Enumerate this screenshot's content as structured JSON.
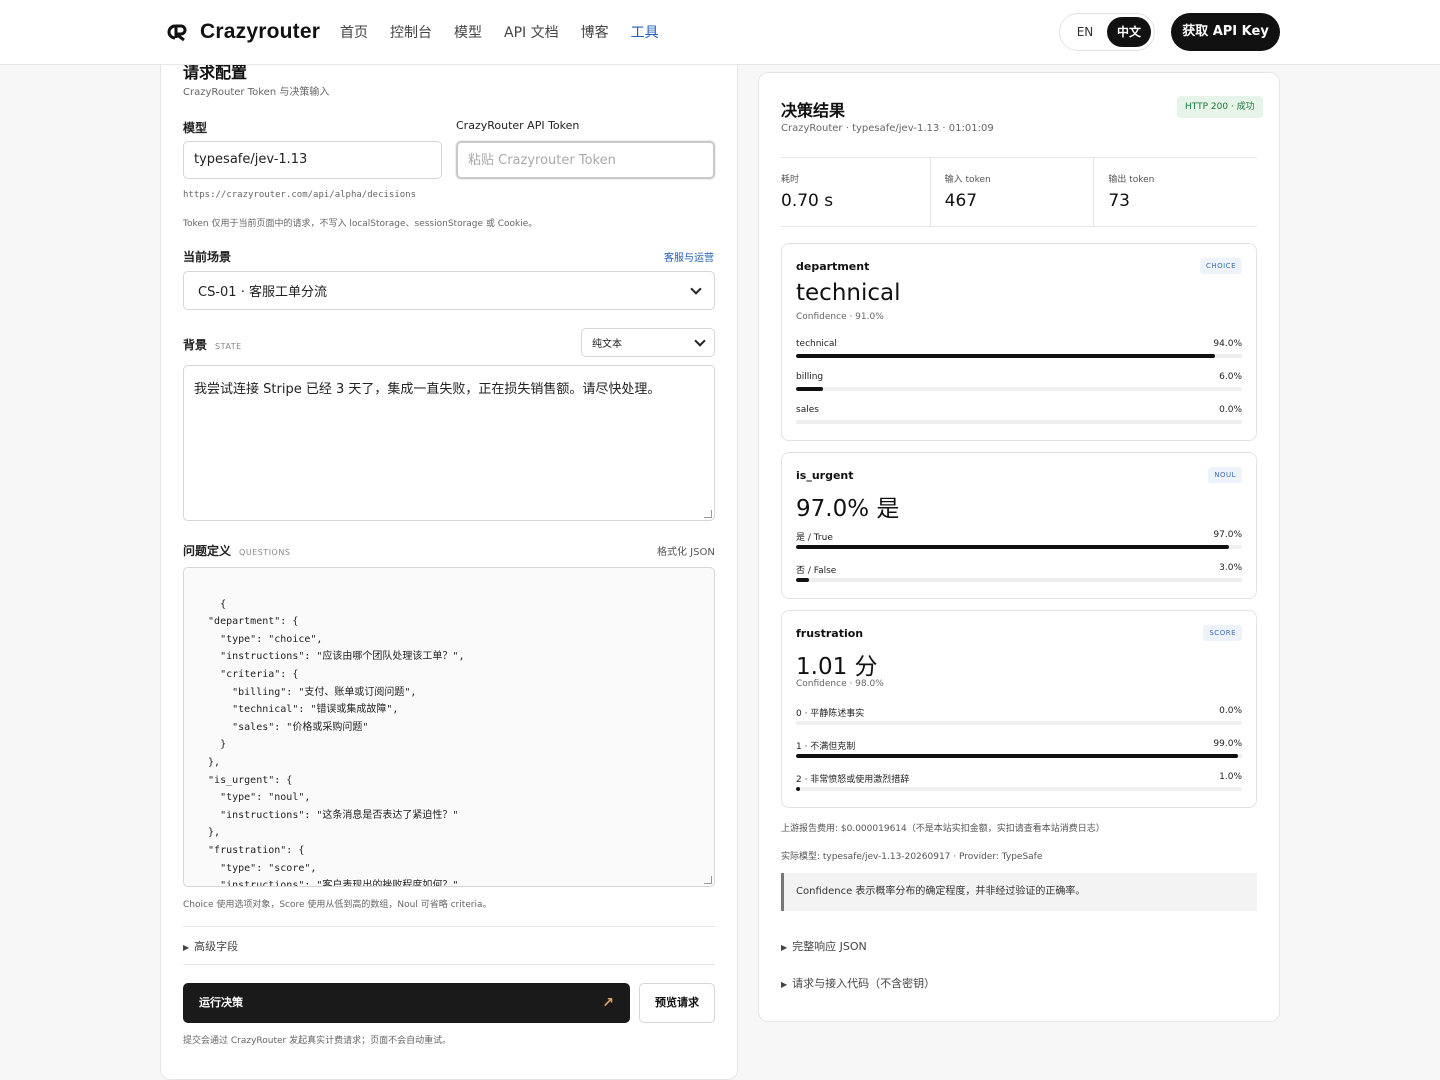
{
  "header": {
    "brand": "Crazyrouter",
    "nav": [
      "首页",
      "控制台",
      "模型",
      "API 文档",
      "博客",
      "工具"
    ],
    "lang_en": "EN",
    "lang_zh": "中文",
    "cta": "获取 API Key"
  },
  "request": {
    "title": "请求配置",
    "subtitle": "CrazyRouter Token 与决策输入",
    "model_label": "模型",
    "model_value": "typesafe/jev-1.13",
    "token_label": "CrazyRouter API Token",
    "token_placeholder": "粘贴 Crazyrouter Token",
    "endpoint": "https://crazyrouter.com/api/alpha/decisions",
    "token_note": "Token 仅用于当前页面中的请求，不写入 localStorage、sessionStorage 或 Cookie。",
    "scenario_label": "当前场景",
    "scenario_link": "客服与运营",
    "scenario_value": "CS-01 · 客服工单分流",
    "state_label": "背景",
    "state_tag": "STATE",
    "format_value": "纯文本",
    "state_text": "我尝试连接 Stripe 已经 3 天了，集成一直失败，正在损失销售额。请尽快处理。",
    "questions_label": "问题定义",
    "questions_tag": "QUESTIONS",
    "format_json": "格式化 JSON",
    "questions_code": "{\n  \"department\": {\n    \"type\": \"choice\",\n    \"instructions\": \"应该由哪个团队处理该工单？\",\n    \"criteria\": {\n      \"billing\": \"支付、账单或订阅问题\",\n      \"technical\": \"错误或集成故障\",\n      \"sales\": \"价格或采购问题\"\n    }\n  },\n  \"is_urgent\": {\n    \"type\": \"noul\",\n    \"instructions\": \"这条消息是否表达了紧迫性？\"\n  },\n  \"frustration\": {\n    \"type\": \"score\",\n    \"instructions\": \"客户表现出的挫败程度如何？\",\n    \"criteria\": [",
    "questions_note": "Choice 使用选项对象，Score 使用从低到高的数组，Noul 可省略 criteria。",
    "advanced": "高级字段",
    "run": "运行决策",
    "preview": "预览请求",
    "submit_note": "提交会通过 CrazyRouter 发起真实计费请求；页面不会自动重试。"
  },
  "result": {
    "title": "决策结果",
    "subtitle": "CrazyRouter · typesafe/jev-1.13 · 01:01:09",
    "status": "HTTP 200 · 成功",
    "stats": [
      {
        "label": "耗时",
        "value": "0.70 s"
      },
      {
        "label": "输入 token",
        "value": "467"
      },
      {
        "label": "输出 token",
        "value": "73"
      }
    ],
    "department": {
      "name": "department",
      "tag": "CHOICE",
      "answer": "technical",
      "confidence": "Confidence · 91.0%",
      "bars": [
        {
          "label": "technical",
          "value": "94.0%",
          "fraction": 0.94
        },
        {
          "label": "billing",
          "value": "6.0%",
          "fraction": 0.06
        },
        {
          "label": "sales",
          "value": "0.0%",
          "fraction": 0.0
        }
      ]
    },
    "is_urgent": {
      "name": "is_urgent",
      "tag": "NOUL",
      "answer": "97.0% 是",
      "bars": [
        {
          "label": "是 / True",
          "value": "97.0%",
          "fraction": 0.97
        },
        {
          "label": "否 / False",
          "value": "3.0%",
          "fraction": 0.03
        }
      ]
    },
    "frustration": {
      "name": "frustration",
      "tag": "SCORE",
      "answer": "1.01 分",
      "confidence": "Confidence · 98.0%",
      "bars": [
        {
          "label": "0 · 平静陈述事实",
          "value": "0.0%",
          "fraction": 0.0
        },
        {
          "label": "1 · 不满但克制",
          "value": "99.0%",
          "fraction": 0.99
        },
        {
          "label": "2 · 非常愤怒或使用激烈措辞",
          "value": "1.0%",
          "fraction": 0.01
        }
      ]
    },
    "cost_note": "上游报告费用: $0.000019614（不是本站实扣金额，实扣请查看本站消费日志）",
    "actual_model": "实际模型: typesafe/jev-1.13-20260917 · Provider: TypeSafe",
    "callout": "Confidence 表示概率分布的确定程度，并非经过验证的正确率。",
    "full_json": "完整响应 JSON",
    "code_snippet": "请求与接入代码（不含密钥）"
  }
}
